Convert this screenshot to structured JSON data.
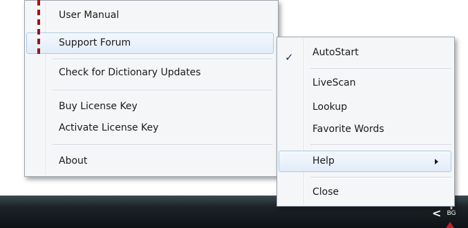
{
  "help_submenu": {
    "items": [
      {
        "label": "User Manual"
      },
      {
        "label": "Support Forum"
      },
      {
        "label": "Check for Dictionary Updates"
      },
      {
        "label": "Buy License Key"
      },
      {
        "label": "Activate License Key"
      },
      {
        "label": "About"
      }
    ]
  },
  "main_menu": {
    "items": [
      {
        "label": "AutoStart",
        "checked": true,
        "check_glyph": "✓"
      },
      {
        "label": "LiveScan"
      },
      {
        "label": "Lookup"
      },
      {
        "label": "Favorite Words"
      },
      {
        "label": "Help",
        "has_submenu": true
      },
      {
        "label": "Close"
      }
    ]
  },
  "taskbar": {
    "chevron_glyph": "<",
    "language_indicator": "BG"
  },
  "colors": {
    "highlight_border": "#aecbe6",
    "dash_marker": "#a3101a",
    "tray_arrow": "#c0202a"
  }
}
